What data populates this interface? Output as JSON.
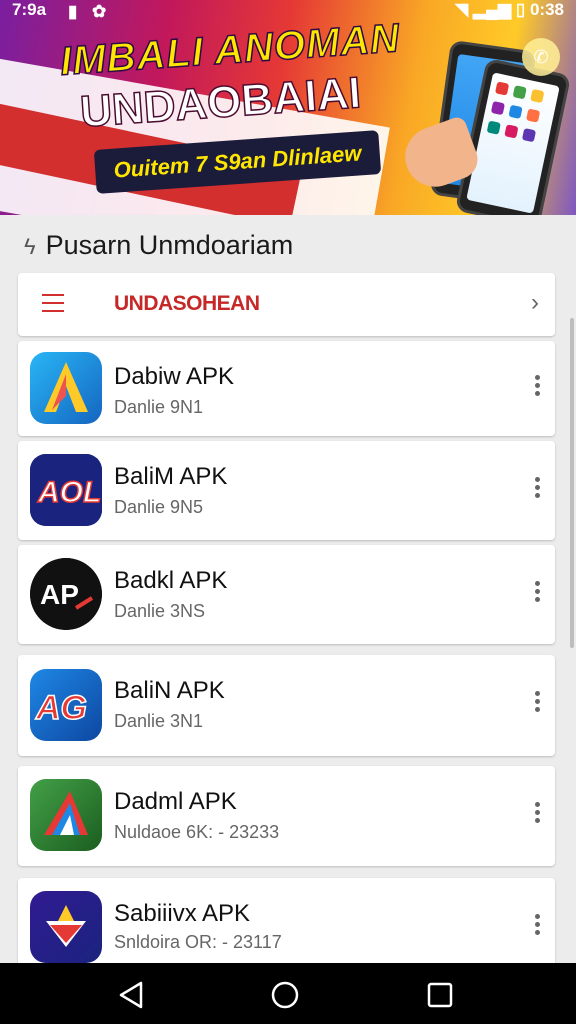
{
  "status_bar": {
    "time": "7:9a",
    "battery_time": "0:38"
  },
  "banner": {
    "headline_line1": "IMBALI ANOMAN",
    "headline_line2": "UNDAOBAIAI",
    "tagline": "Ouitem 7 S9an Dlinlaew"
  },
  "section": {
    "title": "Pusarn Unmdoariam"
  },
  "menu_card": {
    "label": "UNDASOHEAN"
  },
  "apps": [
    {
      "name": "Dabiw APK",
      "sub": "Danlie 9N1"
    },
    {
      "name": "BaliM APK",
      "sub": "Danlie 9N5"
    },
    {
      "name": "Badkl APK",
      "sub": "Danlie 3NS"
    },
    {
      "name": "BaliN APK",
      "sub": "Danlie 3N1"
    },
    {
      "name": "Dadml APK",
      "sub": "Nuldaoe 6K: - 23233"
    },
    {
      "name": "Sabiiivx APK",
      "sub": "Snldoira OR: - 23117"
    }
  ],
  "colors": {
    "accent": "#c62828",
    "navbar": "#000000"
  }
}
